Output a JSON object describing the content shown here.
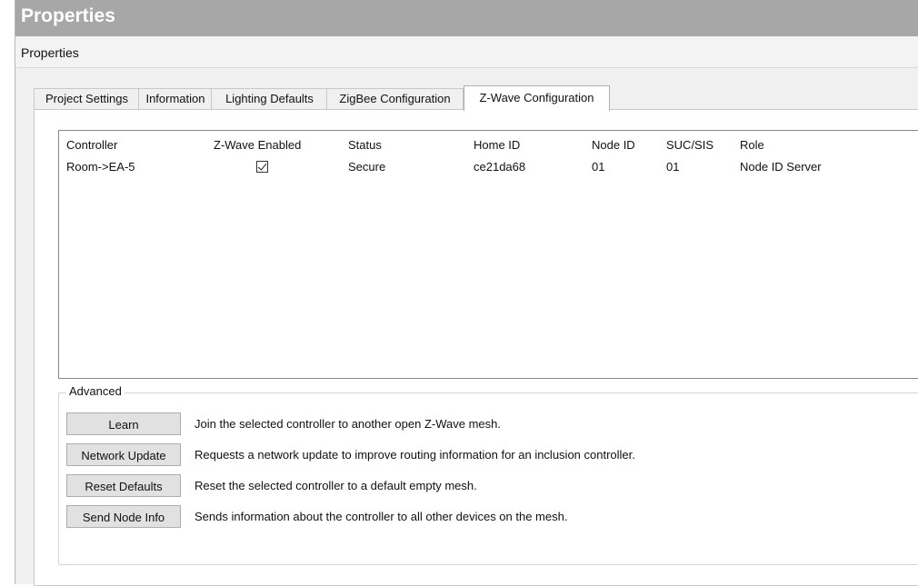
{
  "window": {
    "title": "Properties"
  },
  "subheader": {
    "label": "Properties"
  },
  "tabs": [
    {
      "label": "Project Settings",
      "active": false
    },
    {
      "label": "Information",
      "active": false
    },
    {
      "label": "Lighting Defaults",
      "active": false
    },
    {
      "label": "ZigBee Configuration",
      "active": false
    },
    {
      "label": "Z-Wave Configuration",
      "active": true
    }
  ],
  "table": {
    "columns": [
      "Controller",
      "Z-Wave Enabled",
      "Status",
      "Home ID",
      "Node ID",
      "SUC/SIS",
      "Role"
    ],
    "rows": [
      {
        "controller": "Room->EA-5",
        "zwave_enabled": true,
        "status": "Secure",
        "home_id": "ce21da68",
        "node_id": "01",
        "suc_sis": "01",
        "role": "Node ID Server"
      }
    ]
  },
  "advanced": {
    "label": "Advanced",
    "actions": [
      {
        "button": "Learn",
        "description": "Join the selected controller to another open Z-Wave mesh."
      },
      {
        "button": "Network Update",
        "description": "Requests a network update to improve routing information for an inclusion controller."
      },
      {
        "button": "Reset Defaults",
        "description": "Reset the selected controller to a default empty mesh."
      },
      {
        "button": "Send Node Info",
        "description": "Sends information about the controller to all other devices on the mesh."
      }
    ]
  }
}
